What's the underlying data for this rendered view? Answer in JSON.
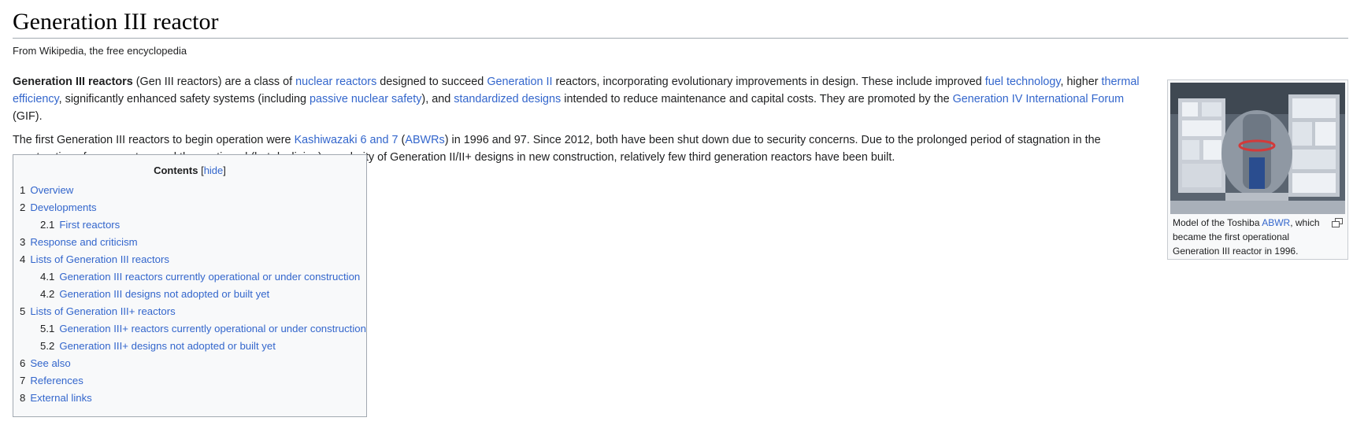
{
  "page": {
    "title": "Generation III reactor",
    "tagline": "From Wikipedia, the free encyclopedia"
  },
  "intro": {
    "p1": {
      "bold": "Generation III reactors",
      "t1": " (Gen III reactors) are a class of ",
      "l1": "nuclear reactors",
      "t2": " designed to succeed ",
      "l2": "Generation II",
      "t3": " reactors, incorporating evolutionary improvements in design. These include improved ",
      "l3": "fuel technology",
      "t4": ", higher ",
      "l4": "thermal efficiency",
      "t5": ", significantly enhanced safety systems (including ",
      "l5": "passive nuclear safety",
      "t6": "), and ",
      "l6": "standardized designs",
      "t7": " intended to reduce maintenance and capital costs. They are promoted by the ",
      "l7": "Generation IV International Forum",
      "t8": " (GIF)."
    },
    "p2": {
      "t1": "The first Generation III reactors to begin operation were ",
      "l1": "Kashiwazaki 6 and 7",
      "t2": " (",
      "l2": "ABWRs",
      "t3": ") in 1996 and 97. Since 2012, both have been shut down due to security concerns. Due to the prolonged period of stagnation in the construction of new reactors and the continued (but declining) popularity of Generation II/II+ designs in new construction, relatively few third generation reactors have been built."
    }
  },
  "figure": {
    "caption_pre": "Model of the Toshiba ",
    "caption_link": "ABWR",
    "caption_post": ", which became the first operational Generation III reactor in 1996."
  },
  "toc": {
    "title": "Contents",
    "toggle_open": "[",
    "toggle_label": "hide",
    "toggle_close": "]",
    "items": [
      {
        "num": "1",
        "label": "Overview"
      },
      {
        "num": "2",
        "label": "Developments"
      },
      {
        "num": "2.1",
        "label": "First reactors"
      },
      {
        "num": "3",
        "label": "Response and criticism"
      },
      {
        "num": "4",
        "label": "Lists of Generation III reactors"
      },
      {
        "num": "4.1",
        "label": "Generation III reactors currently operational or under construction"
      },
      {
        "num": "4.2",
        "label": "Generation III designs not adopted or built yet"
      },
      {
        "num": "5",
        "label": "Lists of Generation III+ reactors"
      },
      {
        "num": "5.1",
        "label": "Generation III+ reactors currently operational or under construction"
      },
      {
        "num": "5.2",
        "label": "Generation III+ designs not adopted or built yet"
      },
      {
        "num": "6",
        "label": "See also"
      },
      {
        "num": "7",
        "label": "References"
      },
      {
        "num": "8",
        "label": "External links"
      }
    ]
  },
  "colors": {
    "link": "#3366cc",
    "text": "#202122",
    "border": "#a2a9b1",
    "toc_bg": "#f8f9fa"
  }
}
